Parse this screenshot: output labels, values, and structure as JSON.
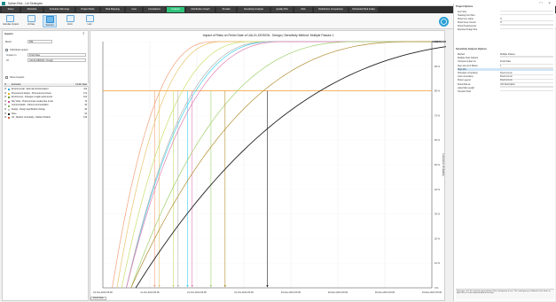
{
  "window": {
    "title": "Safran Risk - Ltd Strategies",
    "controls": [
      "–",
      "☐",
      "✕"
    ]
  },
  "tabs": [
    "Setup",
    "Schedule",
    "Schedule Warnings",
    "Project Risks",
    "Risk Mapping",
    "Cost",
    "Correlations",
    "Analysis",
    "Distribution Graph",
    "Tornado",
    "Sensitivity Analysis",
    "Quality Plot",
    "Risk",
    "Distribution Comparison",
    "Scheduled Risk Intake"
  ],
  "active_tab": "Analysis",
  "toolbar": {
    "buttons": [
      "Calculate Impacts",
      "All Data",
      "Selected",
      "Zoom",
      "Lock"
    ],
    "selected": "Selected"
  },
  "impacts": {
    "title": "Impacts",
    "metric_label": "Metric",
    "metric_value": "P80",
    "individual_impacts_label": "Individual impacts",
    "targets": [
      {
        "label": "Impact on",
        "value": "Finish Date"
      },
      {
        "label": "Of",
        "value": "UIA-01-DESIGN - Design"
      }
    ],
    "show_impacts_label": "Show Impacts",
    "columns": [
      "",
      "Excluded",
      "Finish Date"
    ],
    "rows": [
      {
        "name": "Environmental - External and Associated",
        "value": "11d",
        "color": "#2aa7d6"
      },
      {
        "name": "Procurement Delays - Procurement process",
        "value": "17d",
        "color": "#e7b224"
      },
      {
        "name": "Environment - Changes in legal requirements",
        "value": "12d",
        "color": "#6c9b2f"
      },
      {
        "name": "Site Visits - Purple process needed due to site",
        "value": "7d",
        "color": "#d04a97"
      },
      {
        "name": "Communication - Indirect communication",
        "value": "9d",
        "color": "#7fb55a"
      },
      {
        "name": "Design - Design specification change",
        "value": "9d",
        "color": "#c9c9c9"
      },
      {
        "name": "None",
        "value": "0d",
        "color": "#222222"
      },
      {
        "name": "U3 - Medium Uncertainty - Medium Default",
        "value": "13d",
        "color": "#d35e3a"
      }
    ]
  },
  "chart": {
    "title": "Impact of Risks on Finish Date of UIA-01-DESIGN - Design | Sensitivity Method: Multiple Passes 1",
    "y_label": "Cumulative Probability",
    "bottom_tab": "Finish Date"
  },
  "chart_data": {
    "type": "line",
    "x": [
      "01-Oct-2013 00:00",
      "11-Oct-2013 00:00",
      "21-Oct-2013 00:00",
      "31-Oct-2013 00:00",
      "10-Nov-2013 00:00",
      "20-Nov-2013 00:00",
      "30-Nov-2013 00:00",
      "10-Dec-2013 00:00"
    ],
    "y_ticks": [
      "0 %",
      "10 %",
      "20 %",
      "30 %",
      "40 %",
      "50 %",
      "60 %",
      "70 %",
      "80 %",
      "90 %",
      "100 %"
    ],
    "ylim": [
      0,
      100
    ],
    "threshold": 80,
    "series": [
      {
        "color": "#f2a07a",
        "start_day": 2,
        "end_day": 24,
        "p80_day": 11
      },
      {
        "color": "#e8c46c",
        "start_day": 3,
        "end_day": 26,
        "p80_day": 12
      },
      {
        "color": "#c7e06a",
        "start_day": 4,
        "end_day": 32,
        "p80_day": 15
      },
      {
        "color": "#3fd0f0",
        "start_day": 5,
        "end_day": 37,
        "p80_day": 18
      },
      {
        "color": "#b2b2b2",
        "start_day": 5,
        "end_day": 36,
        "p80_day": 16
      },
      {
        "color": "#e07fb3",
        "start_day": 5,
        "end_day": 39,
        "p80_day": 19
      },
      {
        "color": "#a0cf6c",
        "start_day": 6,
        "end_day": 55,
        "p80_day": 23
      },
      {
        "color": "#b08d2e",
        "start_day": 6,
        "end_day": 67,
        "p80_day": 26
      },
      {
        "color": "#222222",
        "start_day": 7,
        "end_day": 92,
        "p80_day": 35
      }
    ]
  },
  "properties": {
    "title": "Project Options",
    "general": [
      {
        "k": "Font Size",
        "v": ""
      },
      {
        "k": "Heading Font Size",
        "v": ""
      },
      {
        "k": "Show Icon Label",
        "v": "☐"
      },
      {
        "k": "Show Issue Counts",
        "v": "☐"
      },
      {
        "k": "Show Predecessors",
        "v": ""
      },
      {
        "k": "Exported Image Size",
        "v": ""
      }
    ],
    "sensitivity_title": "Sensitivity Analysis Options",
    "sensitivity": [
      {
        "k": "Method",
        "v": "Multiple Passes"
      },
      {
        "k": "Multiple Pass Options",
        "v": ""
      },
      {
        "k": "Compute impact on",
        "v": "Finish Date"
      },
      {
        "k": "Step size (# of Risks)",
        "v": "1"
      },
      {
        "k": "Step size",
        "v": ""
      },
      {
        "k": "Schedule Uncertainty",
        "v": "Fixed at Low"
      },
      {
        "k": "Cost Uncertainty",
        "v": "Fixed at Low"
      },
      {
        "k": "Show Legend",
        "v": "Fixed at Low"
      },
      {
        "k": "Show Risk as",
        "v": "Unit Description"
      },
      {
        "k": "Label Max Length",
        "v": ""
      },
      {
        "k": "Tornado Chart",
        "v": ""
      }
    ],
    "description": "Step size: sets the minimum percentage of the contingency to run. The contingency is defined as the hours in day. P80 is a curve defined before the step."
  }
}
